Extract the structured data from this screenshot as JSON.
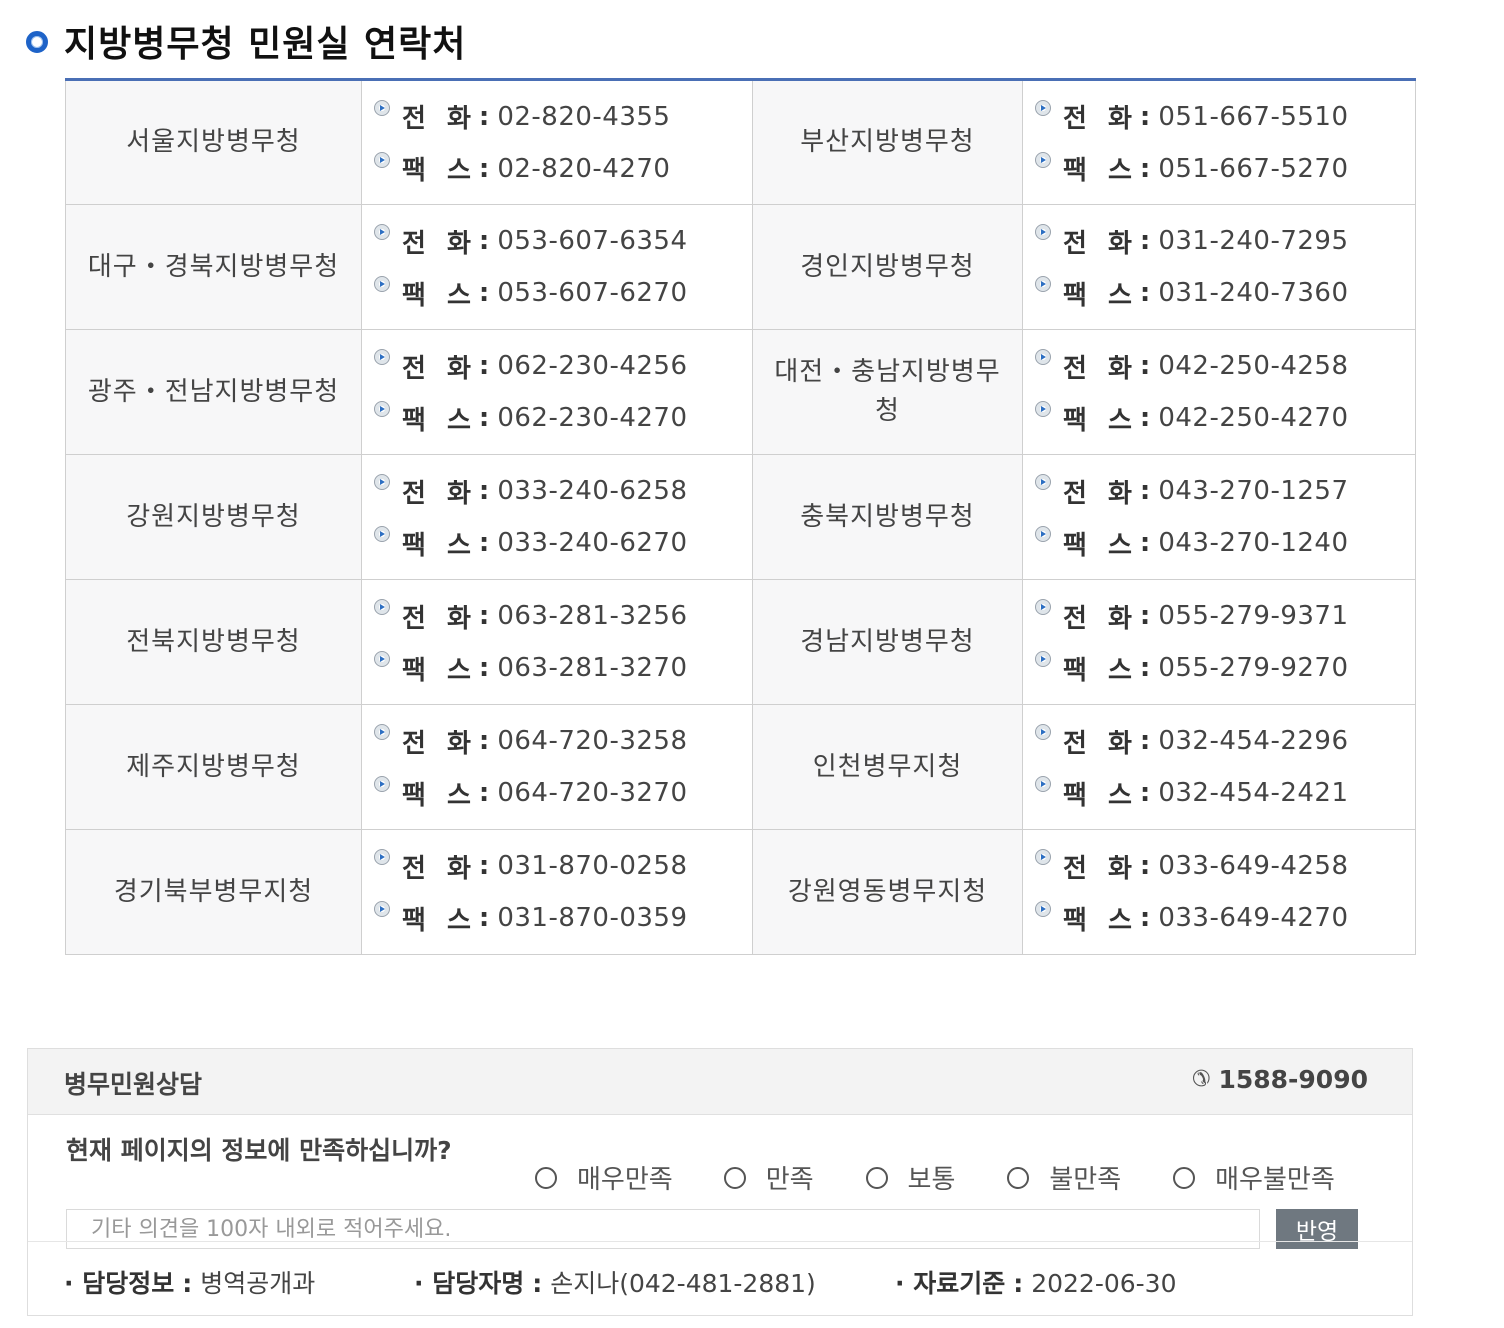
{
  "title": "지방병무청 민원실 연락처",
  "labels": {
    "phone": "전 화",
    "fax": "팩 스",
    "colon": ":"
  },
  "rows": [
    {
      "left": {
        "name": "서울지방병무청",
        "phone": "02-820-4355",
        "fax": "02-820-4270"
      },
      "right": {
        "name": "부산지방병무청",
        "phone": "051-667-5510",
        "fax": "051-667-5270"
      }
    },
    {
      "left": {
        "name": "대구・경북지방병무청",
        "phone": "053-607-6354",
        "fax": "053-607-6270"
      },
      "right": {
        "name": "경인지방병무청",
        "phone": "031-240-7295",
        "fax": "031-240-7360"
      }
    },
    {
      "left": {
        "name": "광주・전남지방병무청",
        "phone": "062-230-4256",
        "fax": "062-230-4270"
      },
      "right": {
        "name": "대전・충남지방병무청",
        "phone": "042-250-4258",
        "fax": "042-250-4270"
      }
    },
    {
      "left": {
        "name": "강원지방병무청",
        "phone": "033-240-6258",
        "fax": "033-240-6270"
      },
      "right": {
        "name": "충북지방병무청",
        "phone": "043-270-1257",
        "fax": "043-270-1240"
      }
    },
    {
      "left": {
        "name": "전북지방병무청",
        "phone": "063-281-3256",
        "fax": "063-281-3270"
      },
      "right": {
        "name": "경남지방병무청",
        "phone": "055-279-9371",
        "fax": "055-279-9270"
      }
    },
    {
      "left": {
        "name": "제주지방병무청",
        "phone": "064-720-3258",
        "fax": "064-720-3270"
      },
      "right": {
        "name": "인천병무지청",
        "phone": "032-454-2296",
        "fax": "032-454-2421"
      }
    },
    {
      "left": {
        "name": "경기북부병무지청",
        "phone": "031-870-0258",
        "fax": "031-870-0359"
      },
      "right": {
        "name": "강원영동병무지청",
        "phone": "033-649-4258",
        "fax": "033-649-4270"
      }
    }
  ],
  "counsel": {
    "title": "병무민원상담",
    "phone_icon": "phone-icon",
    "phone": "1588-9090"
  },
  "survey": {
    "question": "현재 페이지의 정보에 만족하십니까?",
    "options": [
      "매우만족",
      "만족",
      "보통",
      "불만족",
      "매우불만족"
    ],
    "input_placeholder": "기타 의견을 100자 내외로 적어주세요.",
    "submit_label": "반영"
  },
  "info": {
    "dept_key": "· 담당정보",
    "dept_value": "병역공개과",
    "person_key": "· 담당자명",
    "person_value": "손지나(042-481-2881)",
    "date_key": "· 자료기준",
    "date_value": "2022-06-30"
  },
  "colors": {
    "accent": "#1e63c8",
    "table_top_border": "#4a6fb5",
    "button": "#6f7880"
  }
}
